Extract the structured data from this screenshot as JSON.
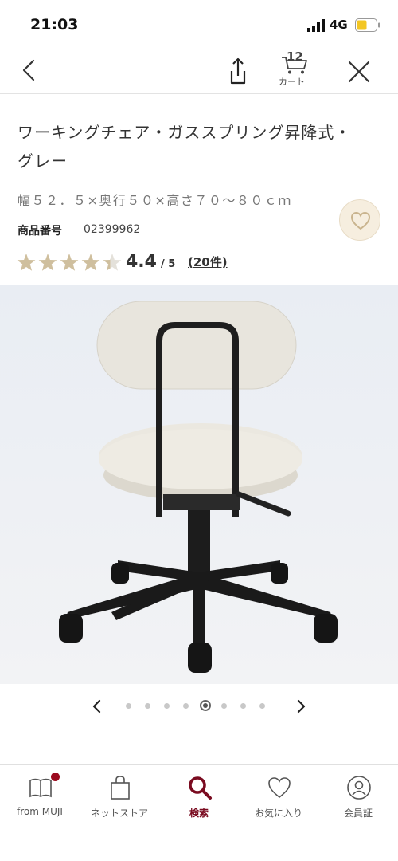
{
  "status_bar": {
    "time": "21:03",
    "network": "4G"
  },
  "nav": {
    "cart_count": "12",
    "cart_label": "カート"
  },
  "product": {
    "title": "ワーキングチェア・ガススプリング昇降式・グレー",
    "dimensions": "幅５２．５×奥行５０×高さ７０～８０ｃｍ",
    "number_label": "商品番号",
    "number_value": "02399962",
    "rating": {
      "score": "4.4",
      "max": "/ 5",
      "review_count": "(20件)",
      "stars_value": 4.4,
      "stars_total": 5
    }
  },
  "carousel": {
    "total": 8,
    "active_index": 4
  },
  "tabs": [
    {
      "label": "from MUJI",
      "icon": "book-icon"
    },
    {
      "label": "ネットストア",
      "icon": "shopping-bag-icon"
    },
    {
      "label": "検索",
      "icon": "search-icon",
      "active": true
    },
    {
      "label": "お気に入り",
      "icon": "heart-icon"
    },
    {
      "label": "会員証",
      "icon": "member-card-icon"
    }
  ],
  "colors": {
    "accent": "#7a0b20",
    "star": "#cfbf9e",
    "favorite_bg": "#f6eedf"
  }
}
